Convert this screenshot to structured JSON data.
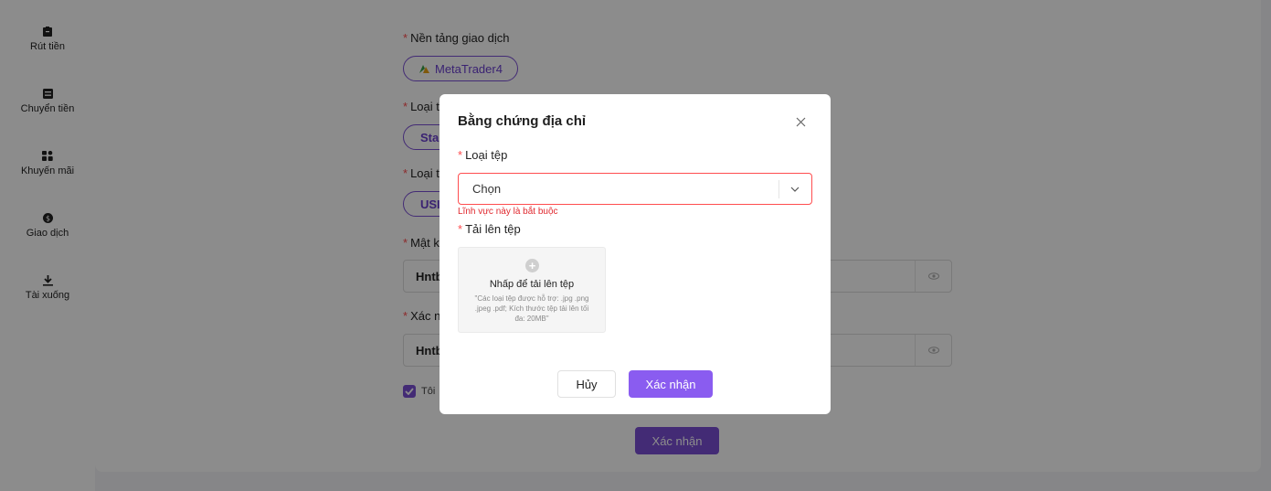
{
  "sidebar": {
    "items": [
      {
        "label": "Rút tiền",
        "icon": "withdraw-icon"
      },
      {
        "label": "Chuyển tiền",
        "icon": "transfer-icon"
      },
      {
        "label": "Khuyến mãi",
        "icon": "promotion-icon"
      },
      {
        "label": "Giao dịch",
        "icon": "trade-icon"
      },
      {
        "label": "Tài xuống",
        "icon": "download-icon"
      }
    ]
  },
  "form": {
    "platform_label": "Nền tảng giao dịch",
    "platform_value": "MetaTrader4",
    "account_type_label": "Loại t",
    "account_type_value": "Sta",
    "currency_label": "Loại t",
    "currency_value": "USI",
    "password_label": "Mật k",
    "password_value": "Hntb",
    "confirm_password_label": "Xác n",
    "confirm_password_value": "Hntb",
    "agree_text": "Tôi",
    "submit_label": "Xác nhận"
  },
  "modal": {
    "title": "Bằng chứng địa chỉ",
    "file_type_label": "Loại tệp",
    "file_type_placeholder": "Chọn",
    "error_text": "Lĩnh vực này là bắt buộc",
    "upload_label": "Tải lên tệp",
    "upload_title": "Nhấp để tải lên tệp",
    "upload_hint": "\"Các loại tệp được hỗ trợ: .jpg .png .jpeg .pdf; Kích thước tệp tải lên tối đa: 20MB\"",
    "cancel_label": "Hủy",
    "confirm_label": "Xác nhận"
  },
  "colors": {
    "accent": "#7b4fd6",
    "error": "#e0282e"
  }
}
